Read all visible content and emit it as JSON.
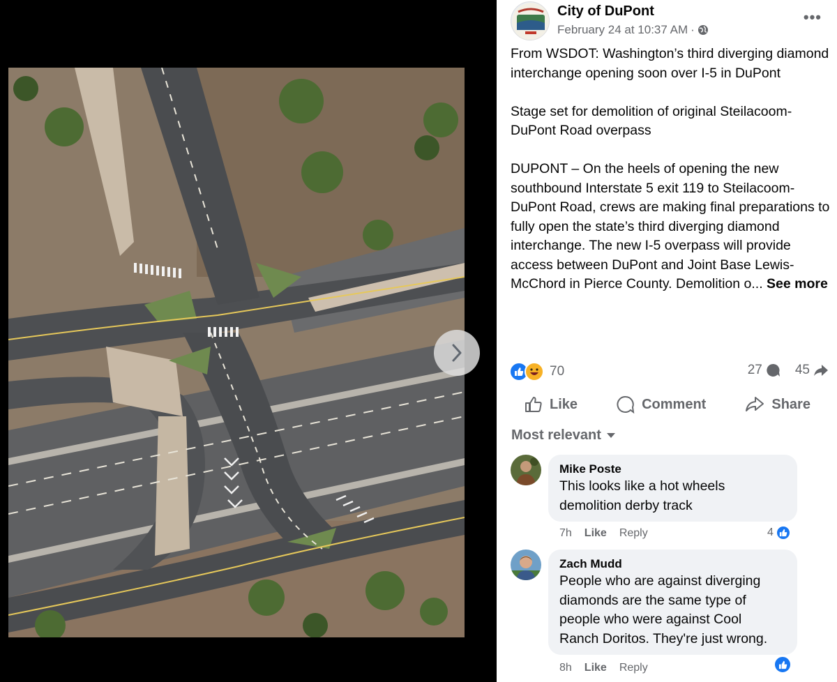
{
  "post": {
    "page_name": "City of DuPont",
    "timestamp": "February 24 at 10:37 AM",
    "separator": "·",
    "audience_icon": "globe-icon",
    "paragraphs": [
      "From WSDOT: Washington’s third diverging diamond interchange opening soon over I-5 in DuPont",
      "Stage set for demolition of original Steilacoom-DuPont Road overpass",
      "DUPONT – On the heels of opening the new southbound Interstate 5 exit 119 to Steilacoom-DuPont Road, crews are making final preparations to fully open the state’s third diverging diamond interchange. The new I-5 overpass will provide access between DuPont and Joint Base Lewis-McChord in Pierce County. Demolition o..."
    ],
    "see_more": "See more",
    "reaction_count": "70",
    "comment_count": "27",
    "share_count": "45"
  },
  "actions": {
    "like": "Like",
    "comment": "Comment",
    "share": "Share"
  },
  "sort_label": "Most relevant",
  "comments": [
    {
      "name": "Mike Poste",
      "lines": [
        "This looks like a hot wheels",
        "demolition derby track"
      ],
      "time": "7h",
      "like": "Like",
      "reply": "Reply",
      "likes": "4"
    },
    {
      "name": "Zach Mudd",
      "lines": [
        "People who are against diverging",
        "diamonds are the same type of",
        "people who were against Cool",
        "Ranch Doritos. They're just wrong."
      ],
      "time": "8h",
      "like": "Like",
      "reply": "Reply",
      "likes": ""
    }
  ],
  "colors": {
    "facebook_blue": "#1877f2",
    "secondary_text": "#65676b",
    "bubble_bg": "#f0f2f5"
  }
}
